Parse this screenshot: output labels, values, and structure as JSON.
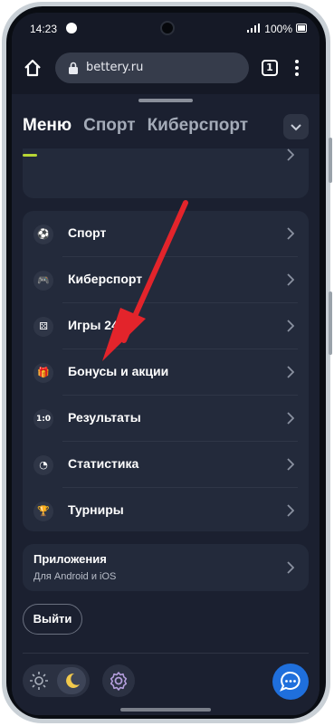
{
  "status_bar": {
    "time": "14:23",
    "battery": "100%"
  },
  "browser": {
    "url": "bettery.ru",
    "tab_count": "1"
  },
  "top_tabs": [
    "Меню",
    "Спорт",
    "Киберспорт"
  ],
  "menu": {
    "items": [
      {
        "label": "Спорт",
        "icon": "soccer-ball-icon"
      },
      {
        "label": "Киберспорт",
        "icon": "gamepad-icon"
      },
      {
        "label": "Игры 24/7",
        "icon": "dice-icon"
      },
      {
        "label": "Бонусы и акции",
        "icon": "gift-icon"
      },
      {
        "label": "Результаты",
        "icon": "score-icon",
        "glyph": "1:0"
      },
      {
        "label": "Статистика",
        "icon": "stats-icon"
      },
      {
        "label": "Турниры",
        "icon": "trophy-icon"
      }
    ]
  },
  "apps": {
    "title": "Приложения",
    "subtitle": "Для Android и iOS"
  },
  "logout_label": "Выйти",
  "colors": {
    "accent": "#b8d634",
    "chat": "#1f6fdc",
    "arrow": "#e3242b"
  }
}
